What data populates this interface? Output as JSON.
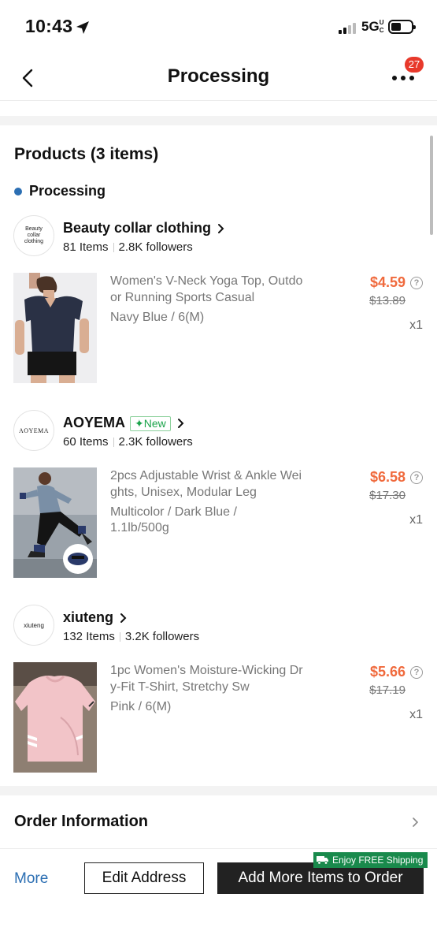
{
  "status_bar": {
    "time": "10:43",
    "network": "5G",
    "network_sub": "UC"
  },
  "header": {
    "title": "Processing",
    "badge_count": "27"
  },
  "products": {
    "section_title": "Products (3 items)",
    "status_label": "Processing",
    "status_color": "#2c6fb3",
    "stores": [
      {
        "name": "Beauty collar clothing",
        "logo_text": "Beauty collar clothing",
        "items": "81 Items",
        "followers": "2.8K followers",
        "product": {
          "title": "Women's V-Neck Yoga Top, Outdoor Running Sports Casual",
          "variant": "Navy Blue / 6(M)",
          "price": "$4.59",
          "original_price": "$13.89",
          "qty": "x1"
        }
      },
      {
        "name": "AOYEMA",
        "logo_text": "AOYEMA",
        "new_tag": "New",
        "items": "60 Items",
        "followers": "2.3K followers",
        "product": {
          "title": "2pcs Adjustable Wrist & Ankle Weights, Unisex, Modular Leg",
          "variant": "Multicolor / Dark Blue / 1.1lb/500g",
          "price": "$6.58",
          "original_price": "$17.30",
          "qty": "x1"
        }
      },
      {
        "name": "xiuteng",
        "logo_text": "xiuteng",
        "items": "132 Items",
        "followers": "3.2K followers",
        "product": {
          "title": "1pc Women's Moisture-Wicking Dry-Fit T-Shirt, Stretchy Sw",
          "variant": "Pink / 6(M)",
          "price": "$5.66",
          "original_price": "$17.19",
          "qty": "x1"
        }
      }
    ]
  },
  "order_info": {
    "label": "Order Information"
  },
  "bottom_bar": {
    "more_label": "More",
    "edit_address_label": "Edit Address",
    "add_more_label": "Add More Items to Order",
    "shipping_tag": "Enjoy FREE Shipping"
  },
  "colors": {
    "price": "#f06a3d",
    "accent_blue": "#2c6fb3",
    "badge_red": "#e8392b",
    "ship_green": "#198a4c",
    "new_green": "#1aa34a"
  }
}
